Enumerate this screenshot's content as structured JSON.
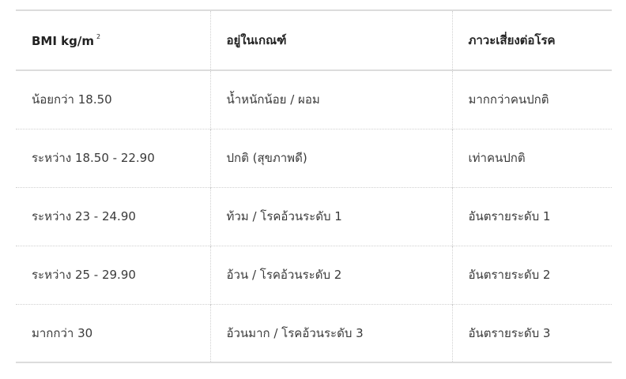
{
  "table": {
    "headers": {
      "bmi": "BMI kg/m",
      "bmi_sup": "2",
      "category": "อยู่ในเกณฑ์",
      "risk": "ภาวะเสี่ยงต่อโรค"
    },
    "rows": [
      {
        "bmi": "น้อยกว่า 18.50",
        "category": "น้ำหนักน้อย / ผอม",
        "risk": "มากกว่าคนปกติ"
      },
      {
        "bmi": "ระหว่าง 18.50 - 22.90",
        "category": "ปกติ (สุขภาพดี)",
        "risk": "เท่าคนปกติ"
      },
      {
        "bmi": "ระหว่าง 23 - 24.90",
        "category": "ท้วม / โรคอ้วนระดับ 1",
        "risk": "อันตรายระดับ 1"
      },
      {
        "bmi": "ระหว่าง 25 - 29.90",
        "category": "อ้วน / โรคอ้วนระดับ 2",
        "risk": "อันตรายระดับ 2"
      },
      {
        "bmi": "มากกว่า 30",
        "category": "อ้วนมาก / โรคอ้วนระดับ 3",
        "risk": "อันตรายระดับ 3"
      }
    ]
  }
}
